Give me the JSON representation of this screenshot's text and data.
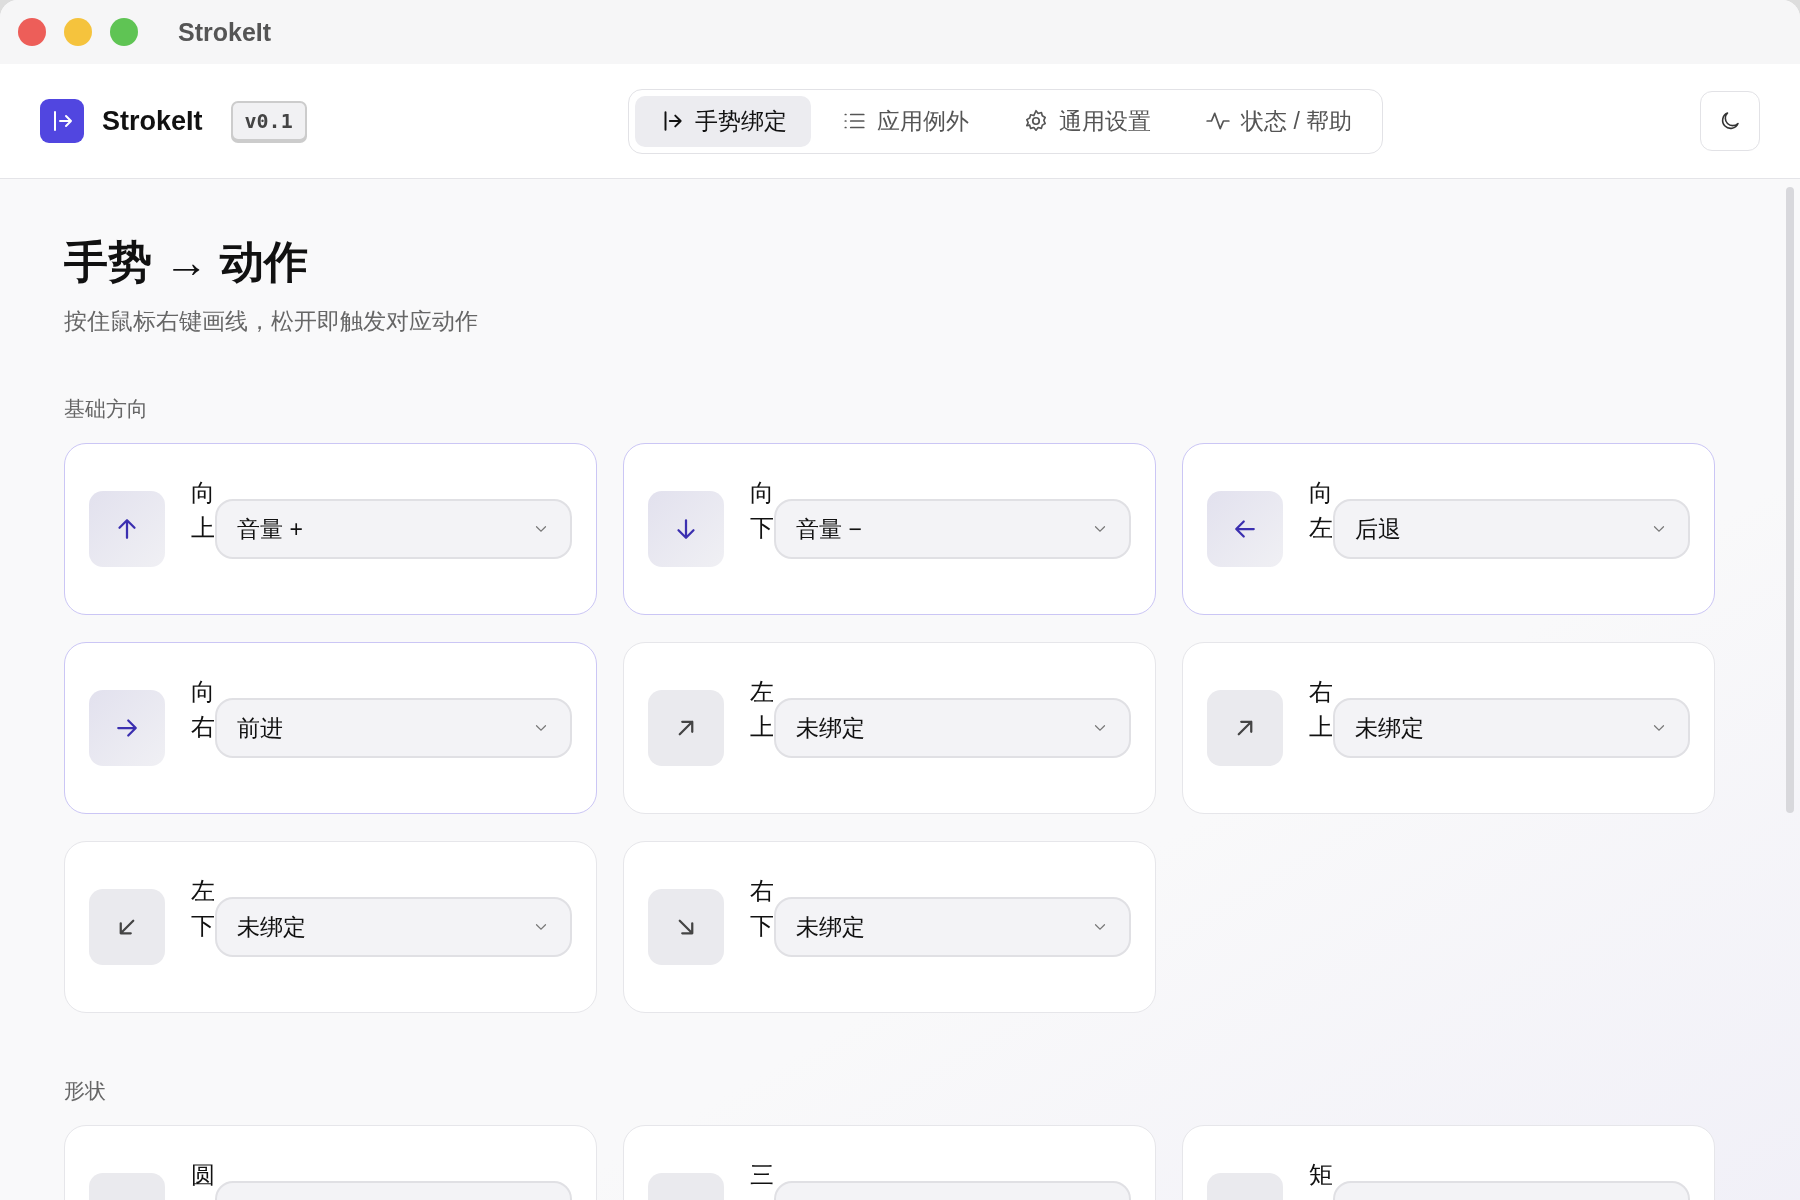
{
  "window": {
    "title": "StrokeIt"
  },
  "header": {
    "app_name": "StrokeIt",
    "version": "v0.1",
    "tabs": [
      {
        "label": "手势绑定",
        "kind": "gesture",
        "selected": true
      },
      {
        "label": "应用例外",
        "kind": "list",
        "selected": false
      },
      {
        "label": "通用设置",
        "kind": "gear",
        "selected": false
      },
      {
        "label": "状态 / 帮助",
        "kind": "pulse",
        "selected": false
      }
    ]
  },
  "page": {
    "title": "手势 → 动作",
    "subtitle": "按住鼠标右键画线，松开即触发对应动作"
  },
  "sections": [
    {
      "title": "基础方向",
      "cards": [
        {
          "label": "向上",
          "kind": "up",
          "value": "音量 +",
          "bound": true
        },
        {
          "label": "向下",
          "kind": "down",
          "value": "音量 −",
          "bound": true
        },
        {
          "label": "向左",
          "kind": "left",
          "value": "后退",
          "bound": true
        },
        {
          "label": "向右",
          "kind": "right",
          "value": "前进",
          "bound": true
        },
        {
          "label": "左上",
          "kind": "up-right",
          "value": "未绑定",
          "bound": false
        },
        {
          "label": "右上",
          "kind": "up-right",
          "value": "未绑定",
          "bound": false
        },
        {
          "label": "左下",
          "kind": "down-left",
          "value": "未绑定",
          "bound": false
        },
        {
          "label": "右下",
          "kind": "down-right",
          "value": "未绑定",
          "bound": false
        }
      ]
    },
    {
      "title": "形状",
      "cards": [
        {
          "label": "圆",
          "bound": false
        },
        {
          "label": "三",
          "bound": false
        },
        {
          "label": "矩",
          "bound": false
        }
      ]
    }
  ]
}
